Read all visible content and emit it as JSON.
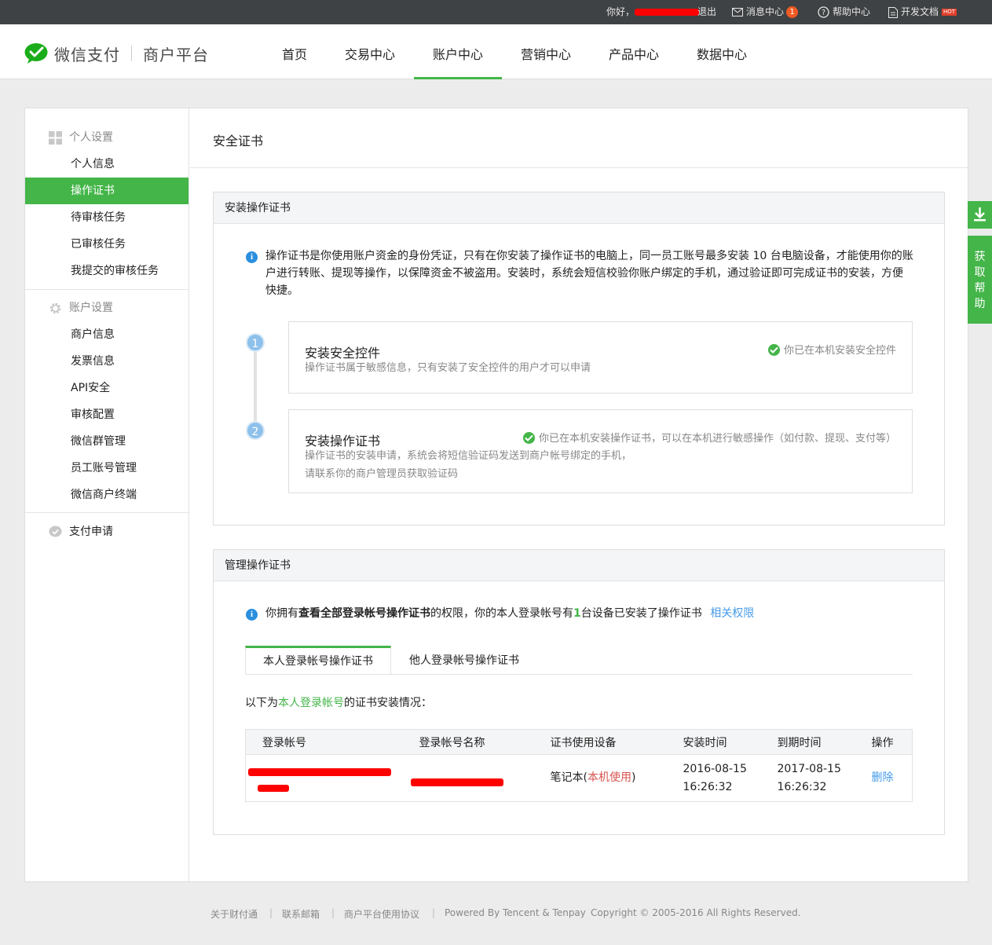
{
  "topbar": {
    "greeting": "你好，",
    "logout": "退出",
    "messages": "消息中心",
    "message_count": "1",
    "help": "帮助中心",
    "docs": "开发文档",
    "docs_badge": "HOT"
  },
  "header": {
    "brand": "微信支付",
    "sub": "商户平台",
    "nav": [
      "首页",
      "交易中心",
      "账户中心",
      "营销中心",
      "产品中心",
      "数据中心"
    ],
    "active_nav": "账户中心"
  },
  "sidebar": {
    "group_personal": "个人设置",
    "personal_items": [
      "个人信息",
      "操作证书",
      "待审核任务",
      "已审核任务",
      "我提交的审核任务"
    ],
    "group_account": "账户设置",
    "account_items": [
      "商户信息",
      "发票信息",
      "API安全",
      "审核配置",
      "微信群管理",
      "员工账号管理",
      "微信商户终端"
    ],
    "group_apply": "支付申请"
  },
  "content": {
    "title": "安全证书",
    "install_box": {
      "header": "安装操作证书",
      "info_line1": "操作证书是你使用账户资金的身份凭证，只有在你安装了操作证书的电脑上，同一员工账号最多安装 10 台电脑设备，才能使用你的账",
      "info_line2": "户进行转账、提现等操作，以保障资金不被盗用。安装时，系统会短信校验你账户绑定的手机，通过验证即可完成证书的安装，方便",
      "info_line3": "快捷。",
      "steps": [
        {
          "num": "1",
          "title": "安装安全控件",
          "desc1": "操作证书属于敏感信息，只有安装了安全控件的用户才可以申请",
          "desc2": "",
          "status": "你已在本机安装安全控件"
        },
        {
          "num": "2",
          "title": "安装操作证书",
          "desc1": "操作证书的安装申请，系统会将短信验证码发送到商户帐号绑定的手机，",
          "desc2": "请联系你的商户管理员获取验证码",
          "status": "你已在本机安装操作证书，可以在本机进行敏感操作（如付款、提现、支付等）"
        }
      ]
    },
    "manage_box": {
      "header": "管理操作证书",
      "info_pre": "你拥有",
      "info_bold": "查看全部登录帐号操作证书",
      "info_mid": "的权限，你的本人登录帐号有",
      "info_count": "1",
      "info_post": "台设备已安装了操作证书",
      "info_link": "相关权限",
      "tabs": [
        "本人登录帐号操作证书",
        "他人登录帐号操作证书"
      ],
      "list_pre": "以下为",
      "list_link": "本人登录帐号",
      "list_post": "的证书安装情况：",
      "table": {
        "headers": [
          "登录帐号",
          "登录帐号名称",
          "证书使用设备",
          "安装时间",
          "到期时间",
          "操作"
        ],
        "row": {
          "device": "笔记本(",
          "device_tag": "本机使用",
          "device_end": ")",
          "install_date": "2016-08-15",
          "install_time": "16:26:32",
          "expire_date": "2017-08-15",
          "expire_time": "16:26:32",
          "action": "删除"
        }
      }
    }
  },
  "float_help": "获取帮助",
  "footer": {
    "links": [
      "关于财付通",
      "联系邮箱",
      "商户平台使用协议"
    ],
    "powered": "Powered By Tencent & Tenpay",
    "copyright": "Copyright © 2005-2016 All Rights Reserved."
  },
  "colors": {
    "brand_green": "#44b549",
    "link_blue": "#459ae9",
    "topbar": "#3f4244"
  }
}
